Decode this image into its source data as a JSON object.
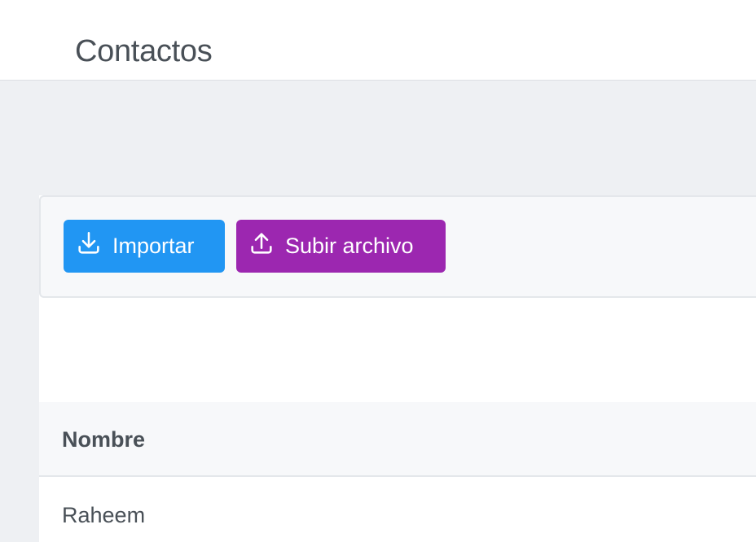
{
  "header": {
    "title": "Contactos"
  },
  "toolbar": {
    "import_label": "Importar",
    "import_icon": "download-icon",
    "import_color": "#2196f3",
    "upload_label": "Subir archivo",
    "upload_icon": "upload-icon",
    "upload_color": "#9c27b0"
  },
  "table": {
    "columns": [
      "Nombre"
    ],
    "rows": [
      {
        "name": "Raheem"
      }
    ]
  }
}
